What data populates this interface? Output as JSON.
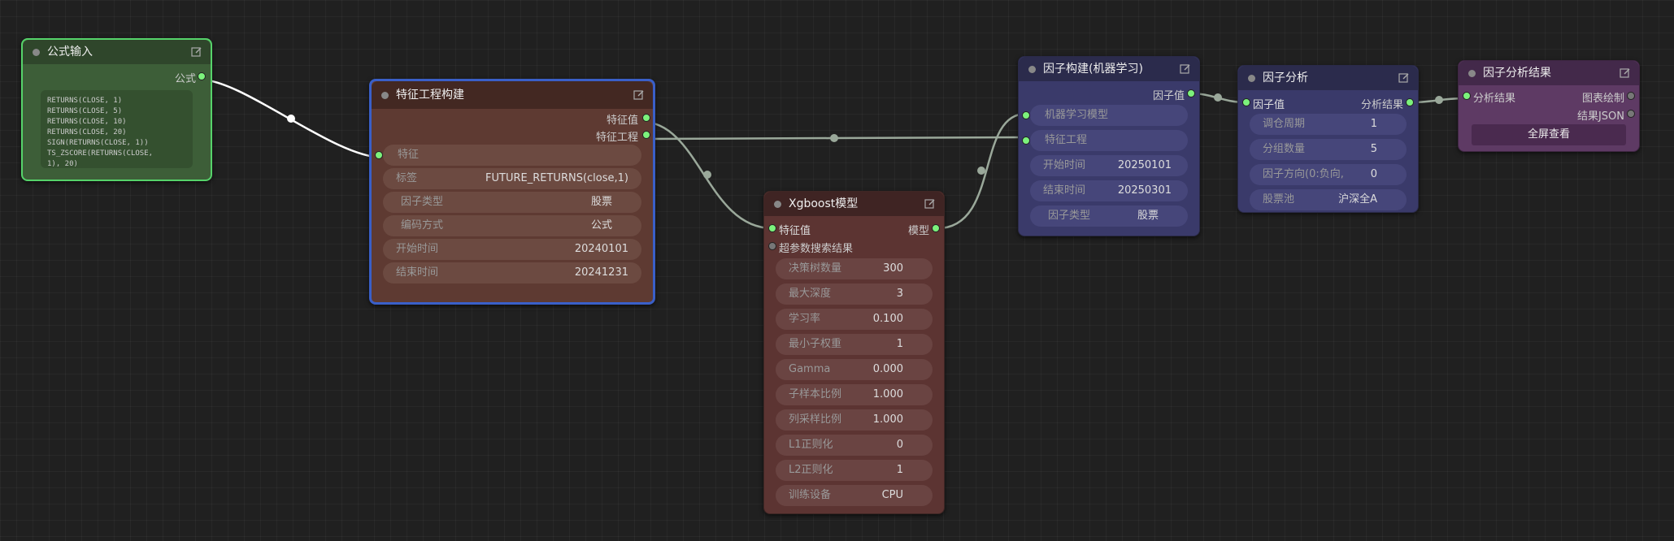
{
  "theme": {
    "link_color": "#9aa89a",
    "active_link_color": "#ffffff",
    "slot_dot_color": "#7cf27c",
    "formula_border": "#56d36a",
    "feature_border": "#3a5fc8"
  },
  "nodes": {
    "formula_input": {
      "title": "公式输入",
      "out_formula": "公式",
      "code": "RETURNS(CLOSE, 1)\nRETURNS(CLOSE, 5)\nRETURNS(CLOSE, 10)\nRETURNS(CLOSE, 20)\nSIGN(RETURNS(CLOSE, 1))\nTS_ZSCORE(RETURNS(CLOSE,\n1), 20)",
      "icon": "edit-icon"
    },
    "feature_eng": {
      "title": "特征工程构建",
      "out_value": "特征值",
      "out_eng": "特征工程",
      "in_feature": "特征",
      "widgets": [
        {
          "label": "标签",
          "value": "FUTURE_RETURNS(close,1)"
        },
        {
          "label": "因子类型",
          "value": "股票"
        },
        {
          "label": "编码方式",
          "value": "公式"
        },
        {
          "label": "开始时间",
          "value": "20240101"
        },
        {
          "label": "结束时间",
          "value": "20241231"
        }
      ]
    },
    "xgboost": {
      "title": "Xgboost模型",
      "in_value": "特征值",
      "in_search": "超参数搜索结果",
      "out_model": "模型",
      "widgets": [
        {
          "label": "决策树数量",
          "value": "300"
        },
        {
          "label": "最大深度",
          "value": "3"
        },
        {
          "label": "学习率",
          "value": "0.100"
        },
        {
          "label": "最小子权重",
          "value": "1"
        },
        {
          "label": "Gamma",
          "value": "0.000"
        },
        {
          "label": "子样本比例",
          "value": "1.000"
        },
        {
          "label": "列采样比例",
          "value": "1.000"
        },
        {
          "label": "L1正则化",
          "value": "0"
        },
        {
          "label": "L2正则化",
          "value": "1"
        },
        {
          "label": "训练设备",
          "value": "CPU"
        }
      ]
    },
    "factor_build": {
      "title": "因子构建(机器学习)",
      "out_value": "因子值",
      "in_model": "机器学习模型",
      "in_eng": "特征工程",
      "widgets": [
        {
          "label": "开始时间",
          "value": "20250101"
        },
        {
          "label": "结束时间",
          "value": "20250301"
        },
        {
          "label": "因子类型",
          "value": "股票"
        }
      ]
    },
    "factor_analysis": {
      "title": "因子分析",
      "in_value": "因子值",
      "out_result": "分析结果",
      "widgets": [
        {
          "label": "调仓周期",
          "value": "1"
        },
        {
          "label": "分组数量",
          "value": "5"
        },
        {
          "label": "因子方向(0:负向,",
          "value": "0"
        },
        {
          "label": "股票池",
          "value": "沪深全A"
        }
      ]
    },
    "factor_result": {
      "title": "因子分析结果",
      "in_result": "分析结果",
      "out_chart": "图表绘制",
      "out_json": "结果JSON",
      "button": "全屏查看"
    }
  }
}
